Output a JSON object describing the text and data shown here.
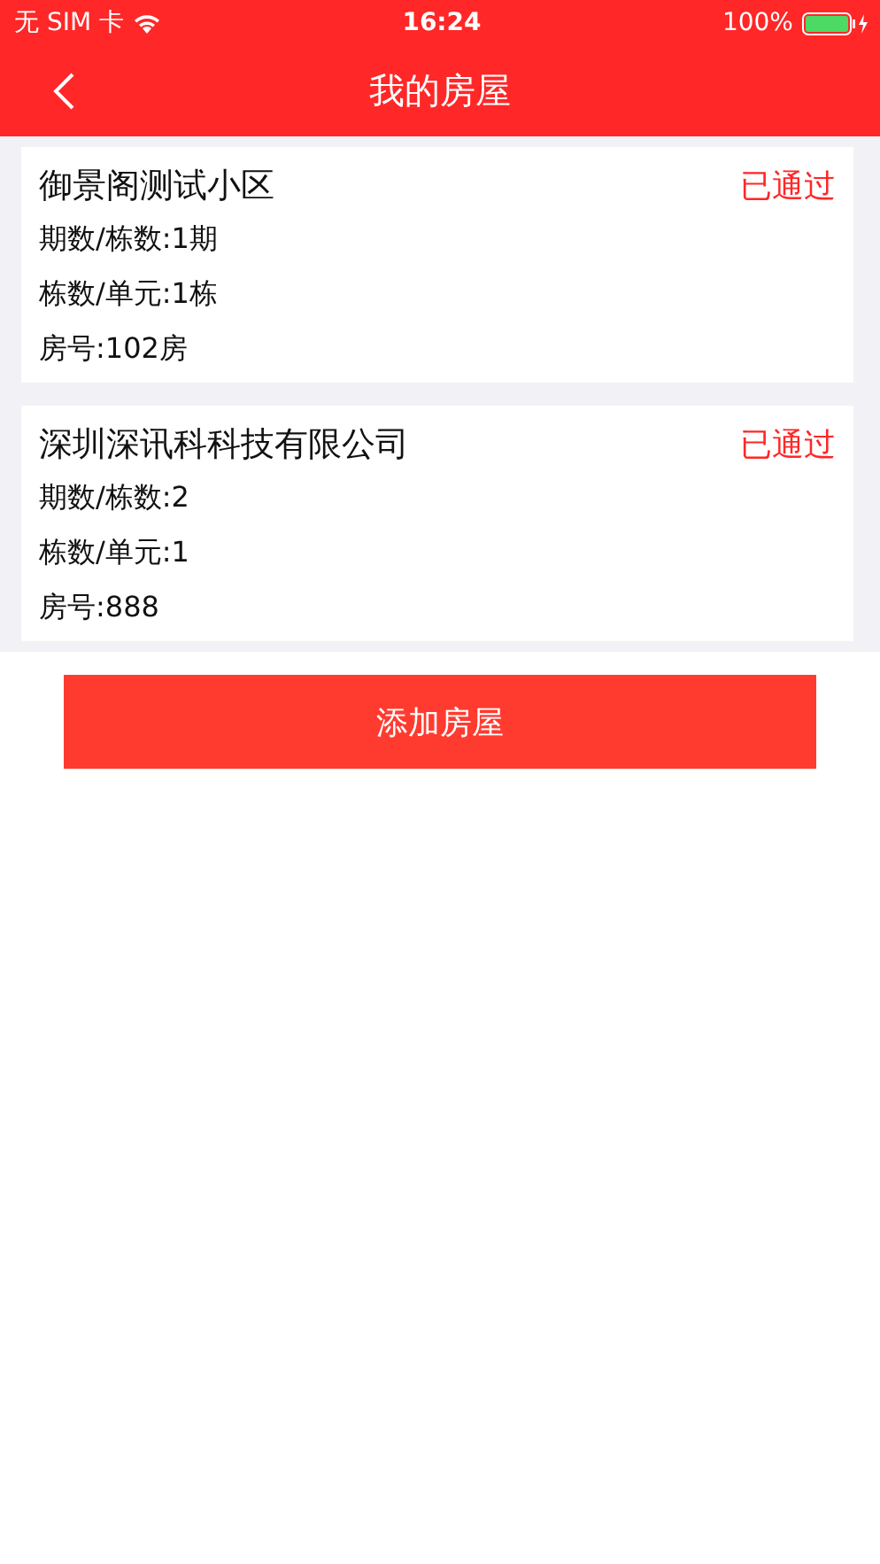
{
  "status_bar": {
    "carrier": "无 SIM 卡",
    "time": "16:24",
    "battery": "100%"
  },
  "nav": {
    "title": "我的房屋"
  },
  "houses": [
    {
      "name": "御景阁测试小区",
      "status": "已通过",
      "lines": [
        "期数/栋数:1期",
        "栋数/单元:1栋",
        "房号:102房"
      ]
    },
    {
      "name": "深圳深讯科科技有限公司",
      "status": "已通过",
      "lines": [
        "期数/栋数:2",
        "栋数/单元:1",
        "房号:888"
      ]
    }
  ],
  "add_button": "添加房屋"
}
